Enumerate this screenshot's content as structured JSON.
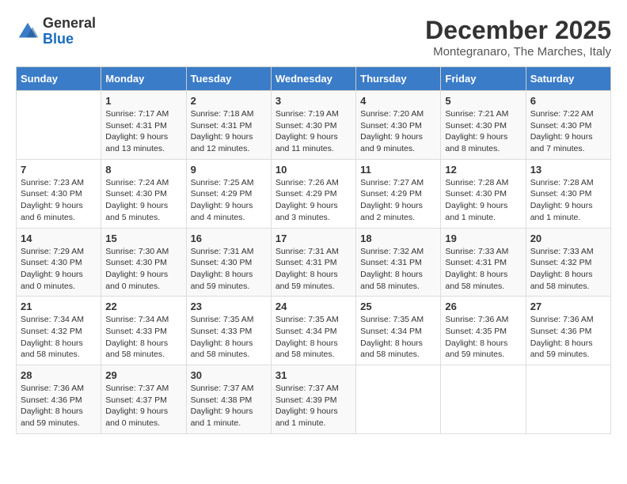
{
  "logo": {
    "general": "General",
    "blue": "Blue"
  },
  "title": "December 2025",
  "subtitle": "Montegranaro, The Marches, Italy",
  "days_of_week": [
    "Sunday",
    "Monday",
    "Tuesday",
    "Wednesday",
    "Thursday",
    "Friday",
    "Saturday"
  ],
  "weeks": [
    [
      {
        "day": "",
        "info": ""
      },
      {
        "day": "1",
        "info": "Sunrise: 7:17 AM\nSunset: 4:31 PM\nDaylight: 9 hours\nand 13 minutes."
      },
      {
        "day": "2",
        "info": "Sunrise: 7:18 AM\nSunset: 4:31 PM\nDaylight: 9 hours\nand 12 minutes."
      },
      {
        "day": "3",
        "info": "Sunrise: 7:19 AM\nSunset: 4:30 PM\nDaylight: 9 hours\nand 11 minutes."
      },
      {
        "day": "4",
        "info": "Sunrise: 7:20 AM\nSunset: 4:30 PM\nDaylight: 9 hours\nand 9 minutes."
      },
      {
        "day": "5",
        "info": "Sunrise: 7:21 AM\nSunset: 4:30 PM\nDaylight: 9 hours\nand 8 minutes."
      },
      {
        "day": "6",
        "info": "Sunrise: 7:22 AM\nSunset: 4:30 PM\nDaylight: 9 hours\nand 7 minutes."
      }
    ],
    [
      {
        "day": "7",
        "info": "Sunrise: 7:23 AM\nSunset: 4:30 PM\nDaylight: 9 hours\nand 6 minutes."
      },
      {
        "day": "8",
        "info": "Sunrise: 7:24 AM\nSunset: 4:30 PM\nDaylight: 9 hours\nand 5 minutes."
      },
      {
        "day": "9",
        "info": "Sunrise: 7:25 AM\nSunset: 4:29 PM\nDaylight: 9 hours\nand 4 minutes."
      },
      {
        "day": "10",
        "info": "Sunrise: 7:26 AM\nSunset: 4:29 PM\nDaylight: 9 hours\nand 3 minutes."
      },
      {
        "day": "11",
        "info": "Sunrise: 7:27 AM\nSunset: 4:29 PM\nDaylight: 9 hours\nand 2 minutes."
      },
      {
        "day": "12",
        "info": "Sunrise: 7:28 AM\nSunset: 4:30 PM\nDaylight: 9 hours\nand 1 minute."
      },
      {
        "day": "13",
        "info": "Sunrise: 7:28 AM\nSunset: 4:30 PM\nDaylight: 9 hours\nand 1 minute."
      }
    ],
    [
      {
        "day": "14",
        "info": "Sunrise: 7:29 AM\nSunset: 4:30 PM\nDaylight: 9 hours\nand 0 minutes."
      },
      {
        "day": "15",
        "info": "Sunrise: 7:30 AM\nSunset: 4:30 PM\nDaylight: 9 hours\nand 0 minutes."
      },
      {
        "day": "16",
        "info": "Sunrise: 7:31 AM\nSunset: 4:30 PM\nDaylight: 8 hours\nand 59 minutes."
      },
      {
        "day": "17",
        "info": "Sunrise: 7:31 AM\nSunset: 4:31 PM\nDaylight: 8 hours\nand 59 minutes."
      },
      {
        "day": "18",
        "info": "Sunrise: 7:32 AM\nSunset: 4:31 PM\nDaylight: 8 hours\nand 58 minutes."
      },
      {
        "day": "19",
        "info": "Sunrise: 7:33 AM\nSunset: 4:31 PM\nDaylight: 8 hours\nand 58 minutes."
      },
      {
        "day": "20",
        "info": "Sunrise: 7:33 AM\nSunset: 4:32 PM\nDaylight: 8 hours\nand 58 minutes."
      }
    ],
    [
      {
        "day": "21",
        "info": "Sunrise: 7:34 AM\nSunset: 4:32 PM\nDaylight: 8 hours\nand 58 minutes."
      },
      {
        "day": "22",
        "info": "Sunrise: 7:34 AM\nSunset: 4:33 PM\nDaylight: 8 hours\nand 58 minutes."
      },
      {
        "day": "23",
        "info": "Sunrise: 7:35 AM\nSunset: 4:33 PM\nDaylight: 8 hours\nand 58 minutes."
      },
      {
        "day": "24",
        "info": "Sunrise: 7:35 AM\nSunset: 4:34 PM\nDaylight: 8 hours\nand 58 minutes."
      },
      {
        "day": "25",
        "info": "Sunrise: 7:35 AM\nSunset: 4:34 PM\nDaylight: 8 hours\nand 58 minutes."
      },
      {
        "day": "26",
        "info": "Sunrise: 7:36 AM\nSunset: 4:35 PM\nDaylight: 8 hours\nand 59 minutes."
      },
      {
        "day": "27",
        "info": "Sunrise: 7:36 AM\nSunset: 4:36 PM\nDaylight: 8 hours\nand 59 minutes."
      }
    ],
    [
      {
        "day": "28",
        "info": "Sunrise: 7:36 AM\nSunset: 4:36 PM\nDaylight: 8 hours\nand 59 minutes."
      },
      {
        "day": "29",
        "info": "Sunrise: 7:37 AM\nSunset: 4:37 PM\nDaylight: 9 hours\nand 0 minutes."
      },
      {
        "day": "30",
        "info": "Sunrise: 7:37 AM\nSunset: 4:38 PM\nDaylight: 9 hours\nand 1 minute."
      },
      {
        "day": "31",
        "info": "Sunrise: 7:37 AM\nSunset: 4:39 PM\nDaylight: 9 hours\nand 1 minute."
      },
      {
        "day": "",
        "info": ""
      },
      {
        "day": "",
        "info": ""
      },
      {
        "day": "",
        "info": ""
      }
    ]
  ]
}
